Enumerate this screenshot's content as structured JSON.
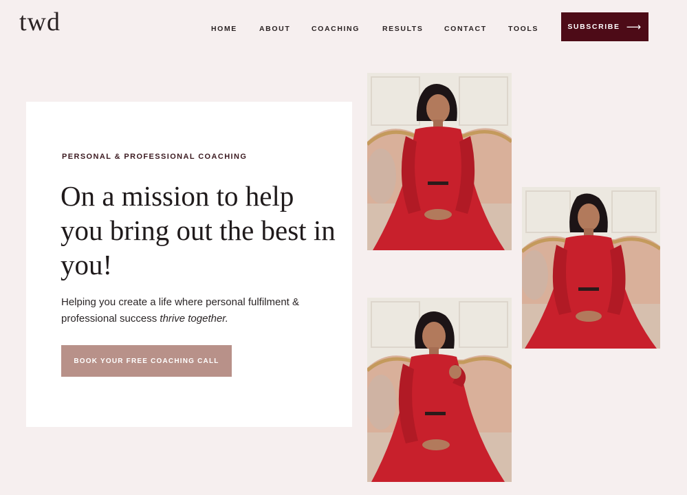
{
  "header": {
    "logo": "twd",
    "nav": [
      {
        "label": "HOME"
      },
      {
        "label": "ABOUT"
      },
      {
        "label": "COACHING"
      },
      {
        "label": "RESULTS"
      },
      {
        "label": "CONTACT"
      },
      {
        "label": "TOOLS"
      }
    ],
    "subscribe_label": "SUBSCRIBE",
    "subscribe_icon": "arrow-right-icon"
  },
  "hero": {
    "eyebrow": "PERSONAL & PROFESSIONAL COACHING",
    "headline": "On a mission to help you bring out the best in you!",
    "subtext_plain": "Helping you create a life where personal fulfilment & professional success ",
    "subtext_italic": "thrive together.",
    "cta_label": "BOOK YOUR FREE COACHING CALL"
  },
  "colors": {
    "background": "#f6efef",
    "subscribe": "#4d0b17",
    "cta": "#b89189",
    "dress": "#c8202c"
  }
}
